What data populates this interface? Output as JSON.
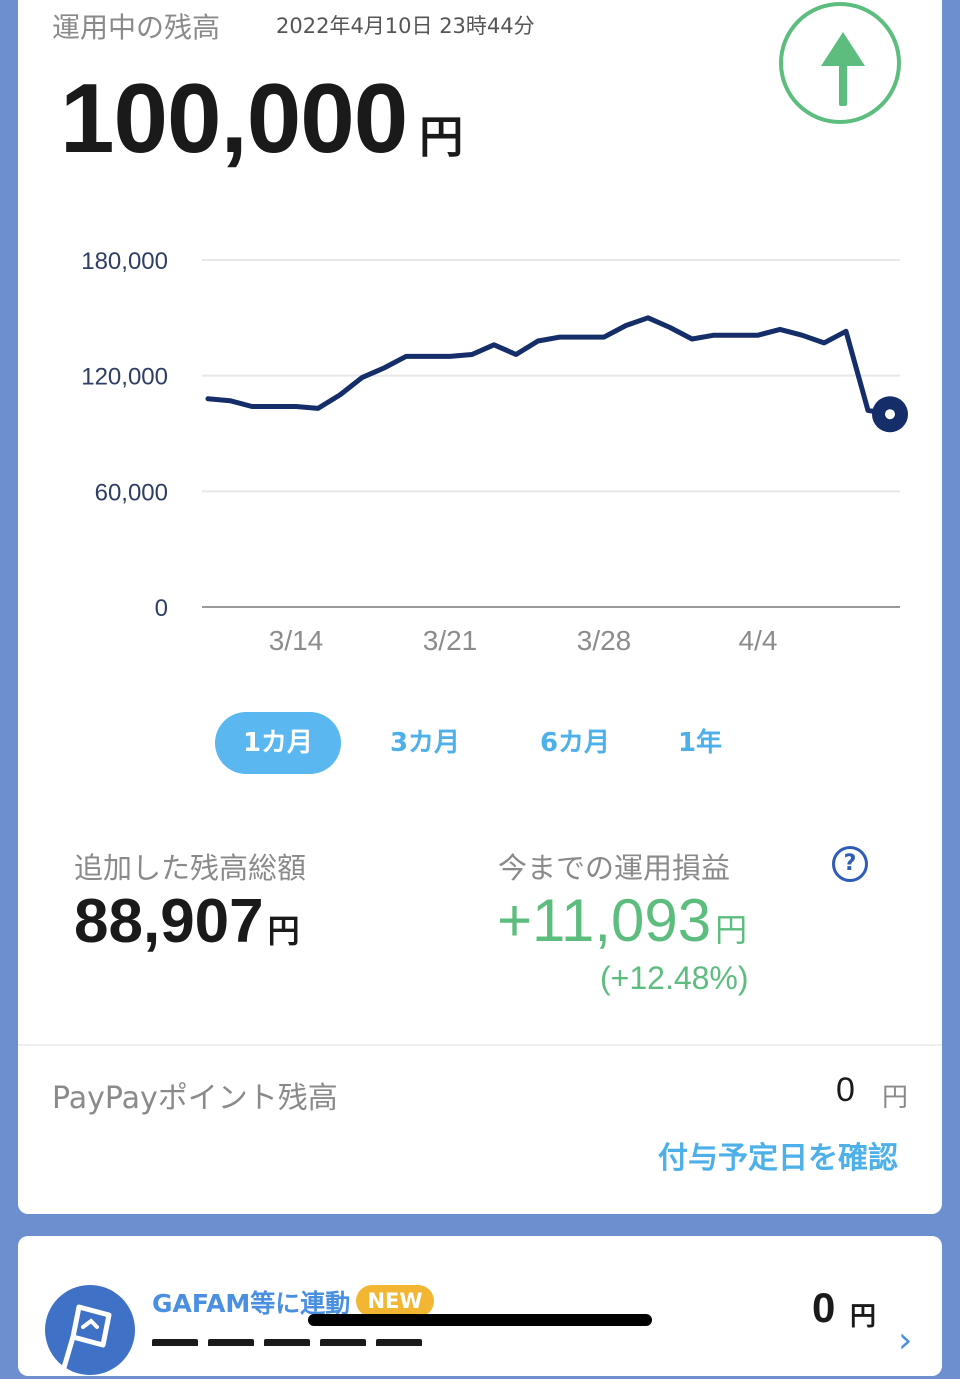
{
  "header": {
    "title": "運用中の残高",
    "datetime": "2022年4月10日 23時44分",
    "balance": "100,000",
    "balance_unit": "円"
  },
  "colors": {
    "line": "#152d69",
    "accent_green": "#5cbd7e",
    "accent_blue": "#5bb7ef",
    "grid": "#e8e8e8"
  },
  "chart_data": {
    "type": "line",
    "ylim": [
      0,
      180000
    ],
    "yticks": [
      0,
      60000,
      120000,
      180000
    ],
    "ytick_labels": [
      "0",
      "60,000",
      "120,000",
      "180,000"
    ],
    "xtick_labels": [
      "3/14",
      "3/21",
      "3/28",
      "4/4"
    ],
    "xtick_days": [
      4,
      11,
      18,
      25
    ],
    "x_days": [
      0,
      1,
      2,
      3,
      4,
      5,
      6,
      7,
      8,
      9,
      10,
      11,
      12,
      13,
      14,
      15,
      16,
      17,
      18,
      19,
      20,
      21,
      22,
      23,
      24,
      25,
      26,
      27,
      28,
      29,
      30,
      31
    ],
    "values": [
      108000,
      107000,
      104000,
      104000,
      104000,
      103000,
      110000,
      119000,
      124000,
      130000,
      130000,
      130000,
      131000,
      136000,
      131000,
      138000,
      140000,
      140000,
      140000,
      146000,
      150000,
      145000,
      139000,
      141000,
      141000,
      141000,
      144000,
      141000,
      137000,
      143000,
      102000,
      100000
    ],
    "grid": true,
    "legend": "none"
  },
  "tabs": [
    {
      "label": "1カ月",
      "active": true
    },
    {
      "label": "3カ月",
      "active": false
    },
    {
      "label": "6カ月",
      "active": false
    },
    {
      "label": "1年",
      "active": false
    }
  ],
  "stats": {
    "added_label": "追加した残高総額",
    "added_value": "88,907",
    "profit_label": "今までの運用損益",
    "profit_value": "+11,093",
    "profit_pct": "(+12.48%)",
    "unit": "円",
    "help": "?"
  },
  "paypay": {
    "label": "PayPayポイント残高",
    "value": "0",
    "unit": "円",
    "link": "付与予定日を確認"
  },
  "gafam": {
    "label": "GAFAM等に連動",
    "badge": "NEW",
    "value": "0",
    "unit": "円",
    "chevron": "›"
  },
  "icons": {
    "up": "arrow-up-icon",
    "help": "help-circle-icon",
    "chevron": "chevron-right-icon",
    "avatar": "flag-icon"
  }
}
